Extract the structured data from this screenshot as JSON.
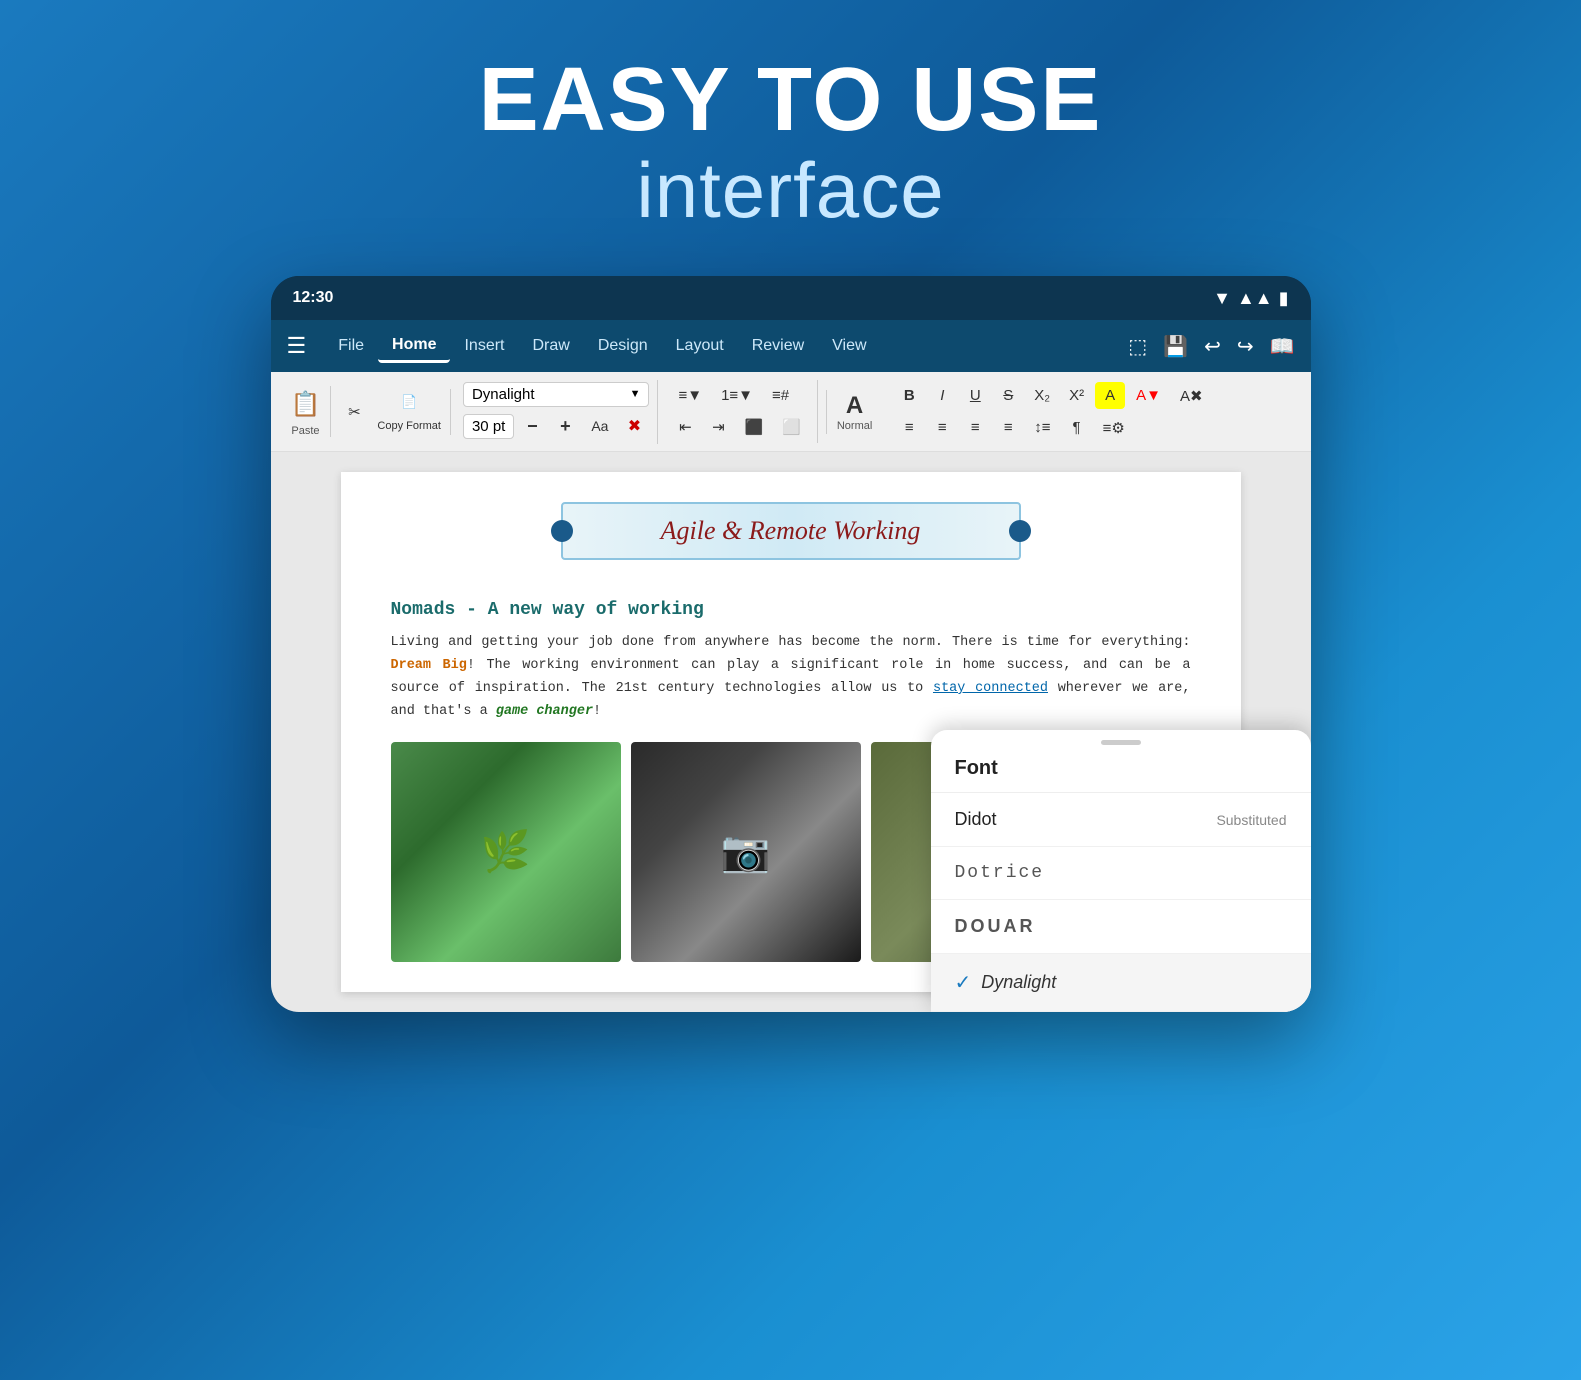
{
  "hero": {
    "title": "EASY TO USE",
    "subtitle": "interface"
  },
  "statusBar": {
    "time": "12:30",
    "icons": [
      "▼▲",
      "▲",
      "▮"
    ]
  },
  "menuBar": {
    "hamburger": "☰",
    "items": [
      {
        "label": "File",
        "active": false
      },
      {
        "label": "Home",
        "active": true
      },
      {
        "label": "Insert",
        "active": false
      },
      {
        "label": "Draw",
        "active": false
      },
      {
        "label": "Design",
        "active": false
      },
      {
        "label": "Layout",
        "active": false
      },
      {
        "label": "Review",
        "active": false
      },
      {
        "label": "View",
        "active": false
      }
    ],
    "rightIcons": [
      "⬛",
      "💾",
      "↩",
      "↪",
      "📖"
    ]
  },
  "toolbar": {
    "fontName": "Dynalight",
    "fontSize": "30 pt",
    "pasteLabel": "Paste",
    "copyFormatLabel": "Copy Format",
    "normalLabel": "Normal",
    "buttons": {
      "bold": "B",
      "italic": "I",
      "underline": "U",
      "strikethrough": "S",
      "sub": "X₂",
      "sup": "X²"
    }
  },
  "document": {
    "titleBanner": "Agile & Remote Working",
    "heading": "Nomads - A new way of working",
    "body": "Living and getting your job done from anywhere has become the norm. There is time for everything:",
    "dreamBig": "Dream Big",
    "bodyMid": "! The working environment can play a significant role in home success, and can be a source of inspiration. The 21st century technologies allow us to",
    "stayConnected": "stay connected",
    "bodyEnd": "wherever we are, and that's a",
    "gameChanger": "game changer",
    "bodyFinal": "!"
  },
  "fontPanel": {
    "title": "Font",
    "items": [
      {
        "name": "Didot",
        "tag": "Substituted",
        "checked": false,
        "style": "normal"
      },
      {
        "name": "Dotrice",
        "tag": "",
        "checked": false,
        "style": "dotrice"
      },
      {
        "name": "DOUAR",
        "tag": "",
        "checked": false,
        "style": "douar"
      },
      {
        "name": "Dynalight",
        "tag": "",
        "checked": true,
        "style": "dynalight"
      }
    ]
  }
}
